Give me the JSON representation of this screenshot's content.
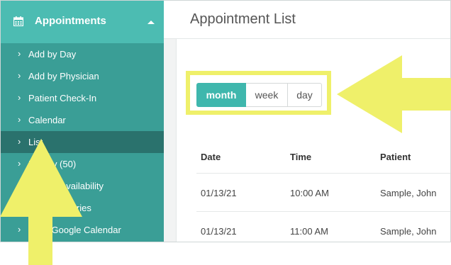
{
  "sidebar": {
    "header": {
      "title": "Appointments",
      "icon": "calendar-icon"
    },
    "items": [
      {
        "label": "Add by Day"
      },
      {
        "label": "Add by Physician"
      },
      {
        "label": "Patient Check-In"
      },
      {
        "label": "Calendar"
      },
      {
        "label": "List",
        "active": true
      },
      {
        "label": "History (50)"
      },
      {
        "label": "Update Availability"
      },
      {
        "label": "Edit Categories"
      },
      {
        "label": "Sync Google Calendar"
      }
    ]
  },
  "main": {
    "title": "Appointment List",
    "view_toggle": {
      "month": "month",
      "week": "week",
      "day": "day",
      "selected": "month"
    },
    "table": {
      "headers": [
        "Date",
        "Time",
        "Patient"
      ],
      "rows": [
        [
          "01/13/21",
          "10:00 AM",
          "Sample, John"
        ],
        [
          "01/13/21",
          "11:00 AM",
          "Sample, John"
        ]
      ]
    }
  },
  "colors": {
    "sidebar": "#3a9e96",
    "sidebar_header": "#4cbcb2",
    "sidebar_active": "#2a726d",
    "accent": "#3fb7ad",
    "annotation": "#eff06a"
  }
}
